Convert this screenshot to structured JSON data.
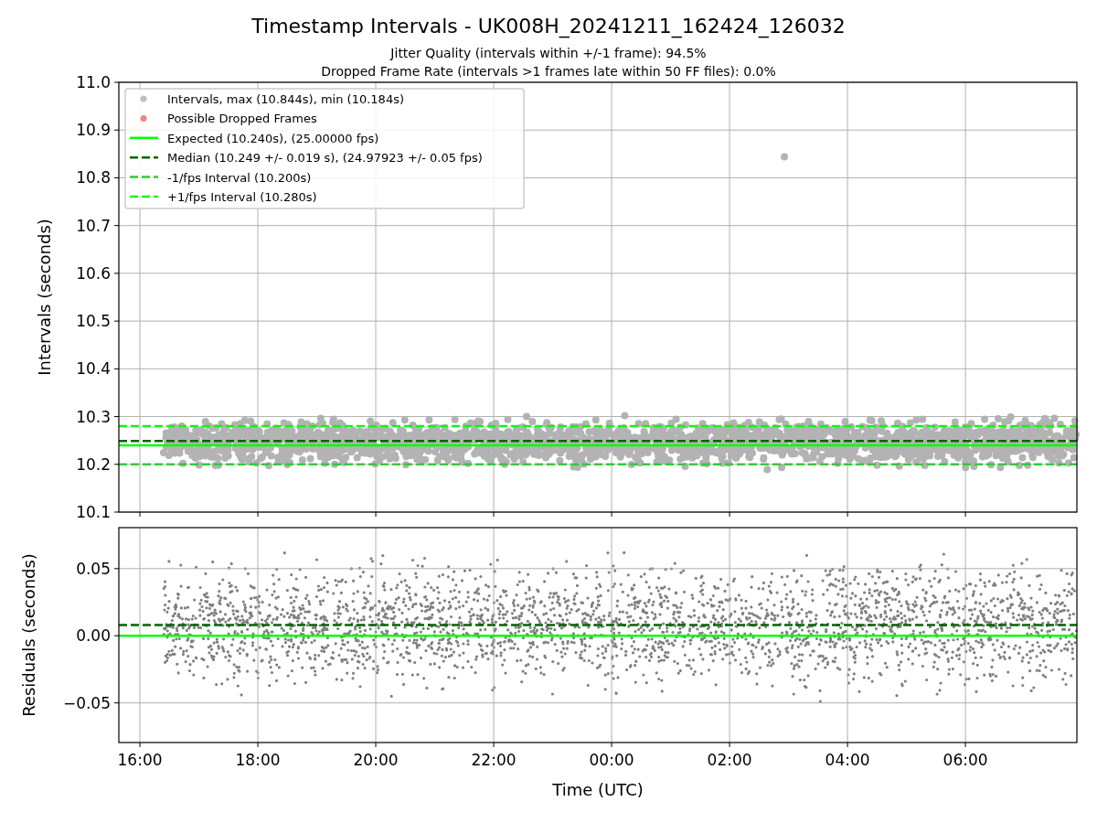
{
  "figure": {
    "title": "Timestamp Intervals - UK008H_20241211_162424_126032",
    "subtitles": [
      "Jitter Quality (intervals within +/-1 frame): 94.5%",
      "Dropped Frame Rate (intervals >1 frames late within 50 FF files): 0.0%"
    ]
  },
  "charts": [
    {
      "chart_data": {
        "type": "scatter",
        "grid": true,
        "ylabel": "Intervals (seconds)",
        "ylim": [
          10.1,
          11.0
        ],
        "yticks": [
          {
            "value": 10.1,
            "label": "10.1"
          },
          {
            "value": 10.2,
            "label": "10.2"
          },
          {
            "value": 10.3,
            "label": "10.3"
          },
          {
            "value": 10.4,
            "label": "10.4"
          },
          {
            "value": 10.5,
            "label": "10.5"
          },
          {
            "value": 10.6,
            "label": "10.6"
          },
          {
            "value": 10.7,
            "label": "10.7"
          },
          {
            "value": 10.8,
            "label": "10.8"
          },
          {
            "value": 10.9,
            "label": "10.9"
          },
          {
            "value": 11.0,
            "label": "11.0"
          }
        ],
        "series": [
          {
            "name": "Intervals, max (10.844s), min (10.184s)",
            "color": "#808080"
          },
          {
            "name": "Possible Dropped Frames",
            "color": "#ff0000"
          }
        ],
        "ref_lines": [
          {
            "axis": "y",
            "value": 10.24,
            "label": "Expected (10.240s), (25.00000 fps)",
            "color": "#00ff00"
          },
          {
            "axis": "y",
            "value": 10.249,
            "label": "Median (10.249 +/- 0.019 s), (24.97923 +/- 0.05 fps)",
            "color": "#006400"
          },
          {
            "axis": "y",
            "value": 10.2,
            "label": "-1/fps Interval (10.200s)",
            "color": "#32cd32"
          },
          {
            "axis": "y",
            "value": 10.28,
            "label": "+1/fps Interval (10.280s)",
            "color": "#00ff00"
          }
        ]
      }
    },
    {
      "chart_data": {
        "type": "scatter",
        "grid": true,
        "xlabel": "Time (UTC)",
        "ylabel": "Residuals (seconds)",
        "categories": [
          "16:00",
          "18:00",
          "20:00",
          "22:00",
          "00:00",
          "02:00",
          "04:00",
          "06:00"
        ],
        "ylim": [
          -0.0795,
          0.0805
        ],
        "yticks": [
          {
            "value": -0.05,
            "label": "−0.05"
          },
          {
            "value": 0,
            "label": "0.00"
          },
          {
            "value": 0.05,
            "label": "0.05"
          }
        ],
        "ref_lines": [
          {
            "axis": "y",
            "value": 0,
            "color": "#00ff00"
          },
          {
            "axis": "y",
            "value": 0.008,
            "color": "#006400"
          }
        ]
      }
    }
  ]
}
